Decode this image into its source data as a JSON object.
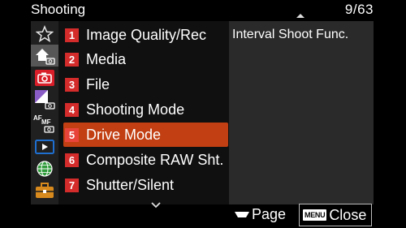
{
  "header": {
    "title": "Shooting",
    "page_indicator": "9/63"
  },
  "sidebar": {
    "icons": [
      {
        "name": "star-icon"
      },
      {
        "name": "home-camera-icon",
        "active": true
      },
      {
        "name": "camera-icon"
      },
      {
        "name": "exposure-camera-icon"
      },
      {
        "name": "af-mf-icon"
      },
      {
        "name": "play-icon"
      },
      {
        "name": "globe-icon"
      },
      {
        "name": "toolbox-icon"
      }
    ]
  },
  "menu": {
    "items": [
      {
        "number": "1",
        "label": "Image Quality/Rec"
      },
      {
        "number": "2",
        "label": "Media"
      },
      {
        "number": "3",
        "label": "File"
      },
      {
        "number": "4",
        "label": "Shooting Mode"
      },
      {
        "number": "5",
        "label": "Drive Mode",
        "selected": true
      },
      {
        "number": "6",
        "label": "Composite RAW Sht."
      },
      {
        "number": "7",
        "label": "Shutter/Silent"
      }
    ]
  },
  "detail": {
    "text": "Interval Shoot Func."
  },
  "footer": {
    "page_label": "Page",
    "menu_badge": "MENU",
    "close_label": "Close"
  },
  "colors": {
    "selected_bg": "#c13f12",
    "number_badge": "#d42b2b",
    "active_tab_bg": "#575757",
    "red_icon_bg": "#d91e2a",
    "blue_icon": "#1e6fd0",
    "green_icon": "#2f9a3a",
    "orange_icon": "#d88a1c"
  }
}
